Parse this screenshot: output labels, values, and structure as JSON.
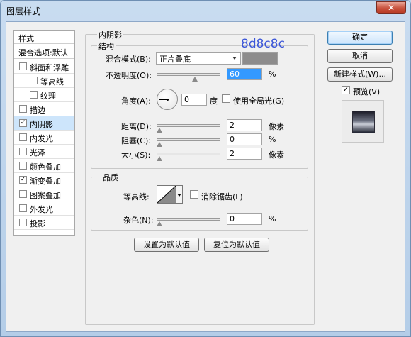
{
  "window": {
    "title": "图层样式",
    "close_glyph": "✕"
  },
  "style_list": {
    "header": "样式",
    "blend_options": "混合选项:默认",
    "items": [
      {
        "label": "斜面和浮雕",
        "checked": false,
        "indent": false
      },
      {
        "label": "等高线",
        "checked": false,
        "indent": true
      },
      {
        "label": "纹理",
        "checked": false,
        "indent": true
      },
      {
        "label": "描边",
        "checked": false,
        "indent": false
      },
      {
        "label": "内阴影",
        "checked": true,
        "indent": false,
        "selected": true
      },
      {
        "label": "内发光",
        "checked": false,
        "indent": false
      },
      {
        "label": "光泽",
        "checked": false,
        "indent": false
      },
      {
        "label": "颜色叠加",
        "checked": false,
        "indent": false
      },
      {
        "label": "渐变叠加",
        "checked": true,
        "indent": false
      },
      {
        "label": "图案叠加",
        "checked": false,
        "indent": false
      },
      {
        "label": "外发光",
        "checked": false,
        "indent": false
      },
      {
        "label": "投影",
        "checked": false,
        "indent": false
      }
    ]
  },
  "inner_shadow": {
    "section_title": "内阴影",
    "structure": {
      "title": "结构",
      "blend_mode_label": "混合模式(B):",
      "blend_mode_value": "正片叠底",
      "shadow_color": "#8d8c8c",
      "color_annotation": "8d8c8c",
      "opacity_label": "不透明度(O):",
      "opacity_value": "60",
      "opacity_unit": "%",
      "opacity_level": 0.6,
      "angle_label": "角度(A):",
      "angle_value": "0",
      "angle_unit": "度",
      "global_light_label": "使用全局光(G)",
      "global_light_checked": false,
      "distance_label": "距离(D):",
      "distance_value": "2",
      "distance_unit": "像素",
      "choke_label": "阻塞(C):",
      "choke_value": "0",
      "choke_unit": "%",
      "size_label": "大小(S):",
      "size_value": "2",
      "size_unit": "像素"
    },
    "quality": {
      "title": "品质",
      "contour_label": "等高线:",
      "anti_alias_label": "消除锯齿(L)",
      "anti_alias_checked": false,
      "noise_label": "杂色(N):",
      "noise_value": "0",
      "noise_unit": "%"
    },
    "make_default": "设置为默认值",
    "reset_default": "复位为默认值"
  },
  "buttons": {
    "ok": "确定",
    "cancel": "取消",
    "new_style": "新建样式(W)...",
    "preview_label": "预览(V)",
    "preview_checked": true
  }
}
